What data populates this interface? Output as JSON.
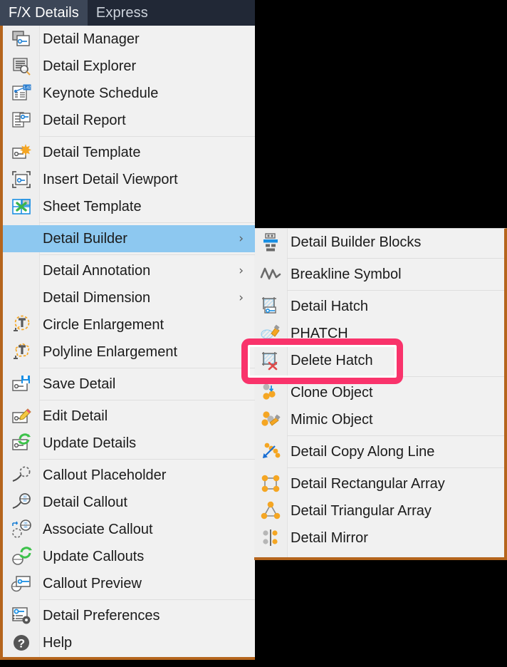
{
  "window": {
    "background_color": "#000000",
    "menu_border_color": "#b5651d",
    "menu_bg_color": "#f1f1f1",
    "highlight_row_color": "#8dc8f0",
    "annotation_color": "#f9336b"
  },
  "menubar": {
    "items": [
      {
        "label": "F/X Details",
        "active": true
      },
      {
        "label": "Express",
        "active": false
      }
    ]
  },
  "menu": {
    "items": [
      {
        "label": "Detail Manager",
        "icon": "detail-manager-icon",
        "submenu": false,
        "separator_after": false
      },
      {
        "label": "Detail Explorer",
        "icon": "detail-explorer-icon",
        "submenu": false,
        "separator_after": false
      },
      {
        "label": "Keynote Schedule",
        "icon": "keynote-schedule-icon",
        "submenu": false,
        "separator_after": false
      },
      {
        "label": "Detail Report",
        "icon": "detail-report-icon",
        "submenu": false,
        "separator_after": true
      },
      {
        "label": "Detail Template",
        "icon": "detail-template-icon",
        "submenu": false,
        "separator_after": false
      },
      {
        "label": "Insert Detail Viewport",
        "icon": "insert-detail-viewport-icon",
        "submenu": false,
        "separator_after": false
      },
      {
        "label": "Sheet Template",
        "icon": "sheet-template-icon",
        "submenu": false,
        "separator_after": true
      },
      {
        "label": "Detail Builder",
        "icon": "none",
        "submenu": true,
        "separator_after": true,
        "highlighted": true
      },
      {
        "label": "Detail Annotation",
        "icon": "none",
        "submenu": true,
        "separator_after": false
      },
      {
        "label": "Detail Dimension",
        "icon": "none",
        "submenu": true,
        "separator_after": false
      },
      {
        "label": "Circle Enlargement",
        "icon": "circle-enlargement-icon",
        "submenu": false,
        "separator_after": false
      },
      {
        "label": "Polyline Enlargement",
        "icon": "polyline-enlargement-icon",
        "submenu": false,
        "separator_after": true
      },
      {
        "label": "Save Detail",
        "icon": "save-detail-icon",
        "submenu": false,
        "separator_after": true
      },
      {
        "label": "Edit Detail",
        "icon": "edit-detail-icon",
        "submenu": false,
        "separator_after": false
      },
      {
        "label": "Update Details",
        "icon": "update-details-icon",
        "submenu": false,
        "separator_after": true
      },
      {
        "label": "Callout Placeholder",
        "icon": "callout-placeholder-icon",
        "submenu": false,
        "separator_after": false
      },
      {
        "label": "Detail Callout",
        "icon": "detail-callout-icon",
        "submenu": false,
        "separator_after": false
      },
      {
        "label": "Associate Callout",
        "icon": "associate-callout-icon",
        "submenu": false,
        "separator_after": false
      },
      {
        "label": "Update Callouts",
        "icon": "update-callouts-icon",
        "submenu": false,
        "separator_after": false
      },
      {
        "label": "Callout Preview",
        "icon": "callout-preview-icon",
        "submenu": false,
        "separator_after": true
      },
      {
        "label": "Detail Preferences",
        "icon": "detail-preferences-icon",
        "submenu": false,
        "separator_after": false
      },
      {
        "label": "Help",
        "icon": "help-icon",
        "submenu": false,
        "separator_after": false
      }
    ]
  },
  "submenu": {
    "parent": "Detail Builder",
    "items": [
      {
        "label": "Detail Builder Blocks",
        "icon": "detail-builder-blocks-icon",
        "separator_after": true
      },
      {
        "label": "Breakline Symbol",
        "icon": "breakline-symbol-icon",
        "separator_after": true
      },
      {
        "label": "Detail Hatch",
        "icon": "detail-hatch-icon",
        "separator_after": false
      },
      {
        "label": "PHATCH",
        "icon": "phatch-icon",
        "separator_after": false
      },
      {
        "label": "Delete Hatch",
        "icon": "delete-hatch-icon",
        "separator_after": true,
        "annotated": true
      },
      {
        "label": "Clone Object",
        "icon": "clone-object-icon",
        "separator_after": false
      },
      {
        "label": "Mimic Object",
        "icon": "mimic-object-icon",
        "separator_after": true
      },
      {
        "label": "Detail Copy Along Line",
        "icon": "detail-copy-along-line-icon",
        "separator_after": true
      },
      {
        "label": "Detail Rectangular Array",
        "icon": "detail-rectangular-array-icon",
        "separator_after": false
      },
      {
        "label": "Detail Triangular Array",
        "icon": "detail-triangular-array-icon",
        "separator_after": false
      },
      {
        "label": "Detail Mirror",
        "icon": "detail-mirror-icon",
        "separator_after": false
      }
    ]
  },
  "annotation": {
    "target_label": "Delete Hatch",
    "shape": "rounded-rectangle",
    "color": "#f9336b"
  }
}
